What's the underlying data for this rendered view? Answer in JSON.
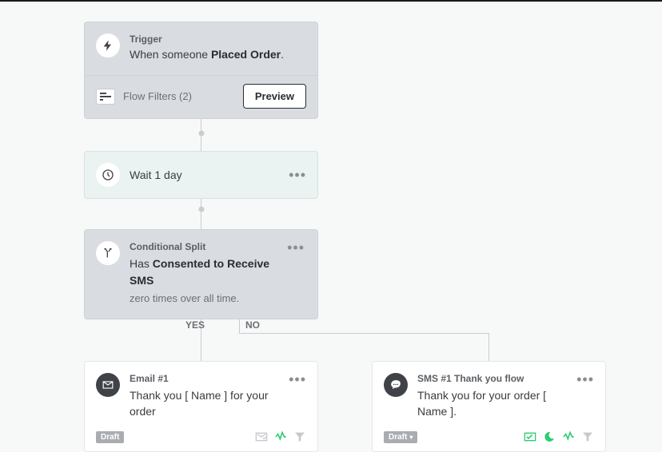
{
  "trigger": {
    "label": "Trigger",
    "text_prefix": "When someone ",
    "event": "Placed Order",
    "text_suffix": ".",
    "filters_label": "Flow Filters (2)",
    "preview_label": "Preview"
  },
  "wait": {
    "text": "Wait 1 day"
  },
  "conditional": {
    "label": "Conditional Split",
    "text_prefix": "Has ",
    "condition": "Consented to Receive SMS",
    "sub": "zero times over all time."
  },
  "branches": {
    "yes": "YES",
    "no": "NO"
  },
  "email": {
    "label": "Email #1",
    "text": "Thank you [ Name ] for your order",
    "status": "Draft"
  },
  "sms": {
    "label": "SMS #1 Thank you flow",
    "text": "Thank you for your order [ Name ].",
    "status": "Draft"
  }
}
